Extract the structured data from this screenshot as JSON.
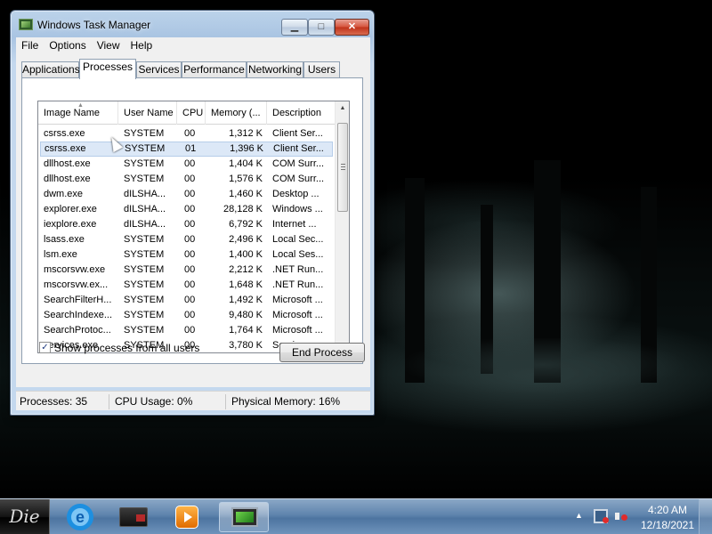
{
  "window": {
    "title": "Windows Task Manager",
    "controls": {
      "minimize": "▁",
      "maximize": "□",
      "close": "✕"
    }
  },
  "menu": [
    "File",
    "Options",
    "View",
    "Help"
  ],
  "tabs": [
    "Applications",
    "Processes",
    "Services",
    "Performance",
    "Networking",
    "Users"
  ],
  "active_tab": "Processes",
  "columns": [
    "Image Name",
    "User Name",
    "CPU",
    "Memory (...",
    "Description"
  ],
  "processes": [
    {
      "name": "csrss.exe",
      "user": "SYSTEM",
      "cpu": "00",
      "mem": "1,312 K",
      "desc": "Client Ser..."
    },
    {
      "name": "csrss.exe",
      "user": "SYSTEM",
      "cpu": "01",
      "mem": "1,396 K",
      "desc": "Client Ser..."
    },
    {
      "name": "dllhost.exe",
      "user": "SYSTEM",
      "cpu": "00",
      "mem": "1,404 K",
      "desc": "COM Surr..."
    },
    {
      "name": "dllhost.exe",
      "user": "SYSTEM",
      "cpu": "00",
      "mem": "1,576 K",
      "desc": "COM Surr..."
    },
    {
      "name": "dwm.exe",
      "user": "dILSHA...",
      "cpu": "00",
      "mem": "1,460 K",
      "desc": "Desktop ..."
    },
    {
      "name": "explorer.exe",
      "user": "dILSHA...",
      "cpu": "00",
      "mem": "28,128 K",
      "desc": "Windows ..."
    },
    {
      "name": "iexplore.exe",
      "user": "dILSHA...",
      "cpu": "00",
      "mem": "6,792 K",
      "desc": "Internet ..."
    },
    {
      "name": "lsass.exe",
      "user": "SYSTEM",
      "cpu": "00",
      "mem": "2,496 K",
      "desc": "Local Sec..."
    },
    {
      "name": "lsm.exe",
      "user": "SYSTEM",
      "cpu": "00",
      "mem": "1,400 K",
      "desc": "Local Ses..."
    },
    {
      "name": "mscorsvw.exe",
      "user": "SYSTEM",
      "cpu": "00",
      "mem": "2,212 K",
      "desc": ".NET Run..."
    },
    {
      "name": "mscorsvw.ex...",
      "user": "SYSTEM",
      "cpu": "00",
      "mem": "1,648 K",
      "desc": ".NET Run..."
    },
    {
      "name": "SearchFilterH...",
      "user": "SYSTEM",
      "cpu": "00",
      "mem": "1,492 K",
      "desc": "Microsoft ..."
    },
    {
      "name": "SearchIndexe...",
      "user": "SYSTEM",
      "cpu": "00",
      "mem": "9,480 K",
      "desc": "Microsoft ..."
    },
    {
      "name": "SearchProtoc...",
      "user": "SYSTEM",
      "cpu": "00",
      "mem": "1,764 K",
      "desc": "Microsoft ..."
    },
    {
      "name": "services.exe",
      "user": "SYSTEM",
      "cpu": "00",
      "mem": "3,780 K",
      "desc": "Services ..."
    }
  ],
  "selected_row": 1,
  "show_all_users": {
    "label": "Show processes from all users",
    "checked": true,
    "mark": "✓"
  },
  "end_process_label": "End Process",
  "status": {
    "processes": "Processes: 35",
    "cpu": "CPU Usage: 0%",
    "memory": "Physical Memory: 16%"
  },
  "scroll": {
    "up": "▲",
    "down": "▼"
  },
  "taskbar": {
    "start_label": "Die",
    "ie_glyph": "e",
    "tray_arrow": "▲",
    "time": "4:20 AM",
    "date": "12/18/2021"
  }
}
